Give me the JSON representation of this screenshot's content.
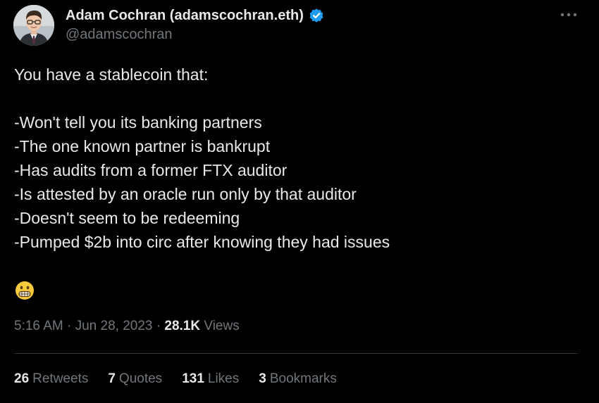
{
  "author": {
    "name": "Adam Cochran (adamscochran.eth)",
    "handle": "@adamscochran",
    "verified_icon": "verified-badge",
    "verified_color": "#1d9bf0"
  },
  "tweet": {
    "lines": [
      "You have a stablecoin that:",
      "",
      "-Won't tell you its banking partners",
      "-The one known partner is bankrupt",
      "-Has audits from a former FTX auditor",
      "-Is attested by an oracle run only by that auditor",
      "-Doesn't seem to be redeeming",
      "-Pumped $2b into circ after knowing they had issues"
    ],
    "emoji": "grimacing-face"
  },
  "meta": {
    "time": "5:16 AM",
    "separator": "·",
    "date": "Jun 28, 2023",
    "views_count": "28.1K",
    "views_label": "Views"
  },
  "stats": {
    "retweets_count": "26",
    "retweets_label": "Retweets",
    "quotes_count": "7",
    "quotes_label": "Quotes",
    "likes_count": "131",
    "likes_label": "Likes",
    "bookmarks_count": "3",
    "bookmarks_label": "Bookmarks"
  },
  "colors": {
    "background": "#000000",
    "text": "#e7e9ea",
    "secondary": "#71767b",
    "divider": "#2f3336"
  }
}
